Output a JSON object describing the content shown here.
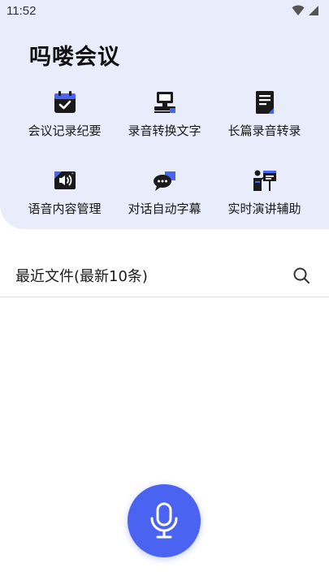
{
  "status_bar": {
    "time": "11:52"
  },
  "app": {
    "title": "吗喽会议"
  },
  "features": [
    {
      "label": "会议记录纪要",
      "icon": "calendar-check-icon"
    },
    {
      "label": "录音转换文字",
      "icon": "recorder-desk-icon"
    },
    {
      "label": "长篇录音转录",
      "icon": "document-lines-icon"
    },
    {
      "label": "语音内容管理",
      "icon": "speaker-card-icon"
    },
    {
      "label": "对话自动字幕",
      "icon": "chat-bubbles-icon"
    },
    {
      "label": "实时演讲辅助",
      "icon": "presenter-board-icon"
    }
  ],
  "recent": {
    "title": "最近文件(最新10条)"
  },
  "colors": {
    "accent": "#4a63f0",
    "header_bg": "#e9ecfb",
    "icon_dark": "#1a1a1a"
  }
}
